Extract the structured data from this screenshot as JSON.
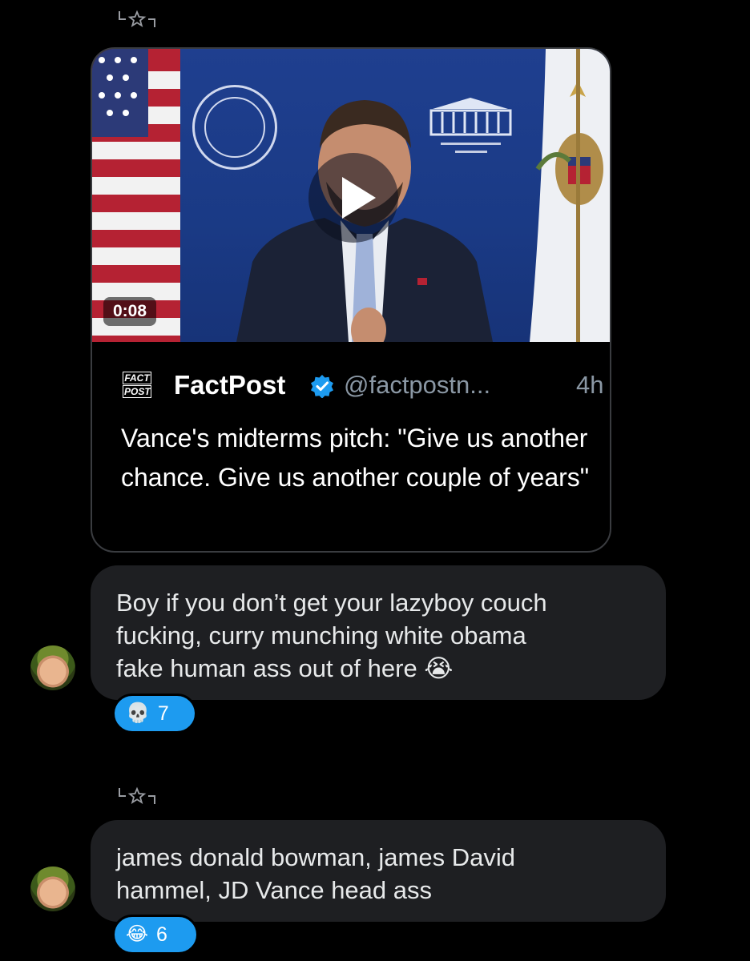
{
  "post": {
    "duration": "0:08",
    "author_name": "FactPost",
    "logo_text": [
      "FACT",
      "POST"
    ],
    "handle": "@factpostn...",
    "time": "4h",
    "text": "Vance's midterms pitch: \"Give us another chance. Give us another couple of years\"",
    "verified_color": "#1d9bf0"
  },
  "messages": [
    {
      "text_lines": [
        "Boy if you don’t get your lazyboy couch",
        "fucking, curry munching white obama",
        "fake human ass out of here 😭"
      ],
      "reaction_emoji": "💀",
      "reaction_count": "7"
    },
    {
      "text_lines": [
        "james donald bowman, james David",
        "hammel, JD Vance head ass"
      ],
      "reaction_emoji": "😂",
      "reaction_count": "6"
    }
  ],
  "colors": {
    "background": "#000000",
    "bubble": "#1e1f22",
    "reaction": "#1d9bf0",
    "secondary_text": "#8b98a5"
  }
}
